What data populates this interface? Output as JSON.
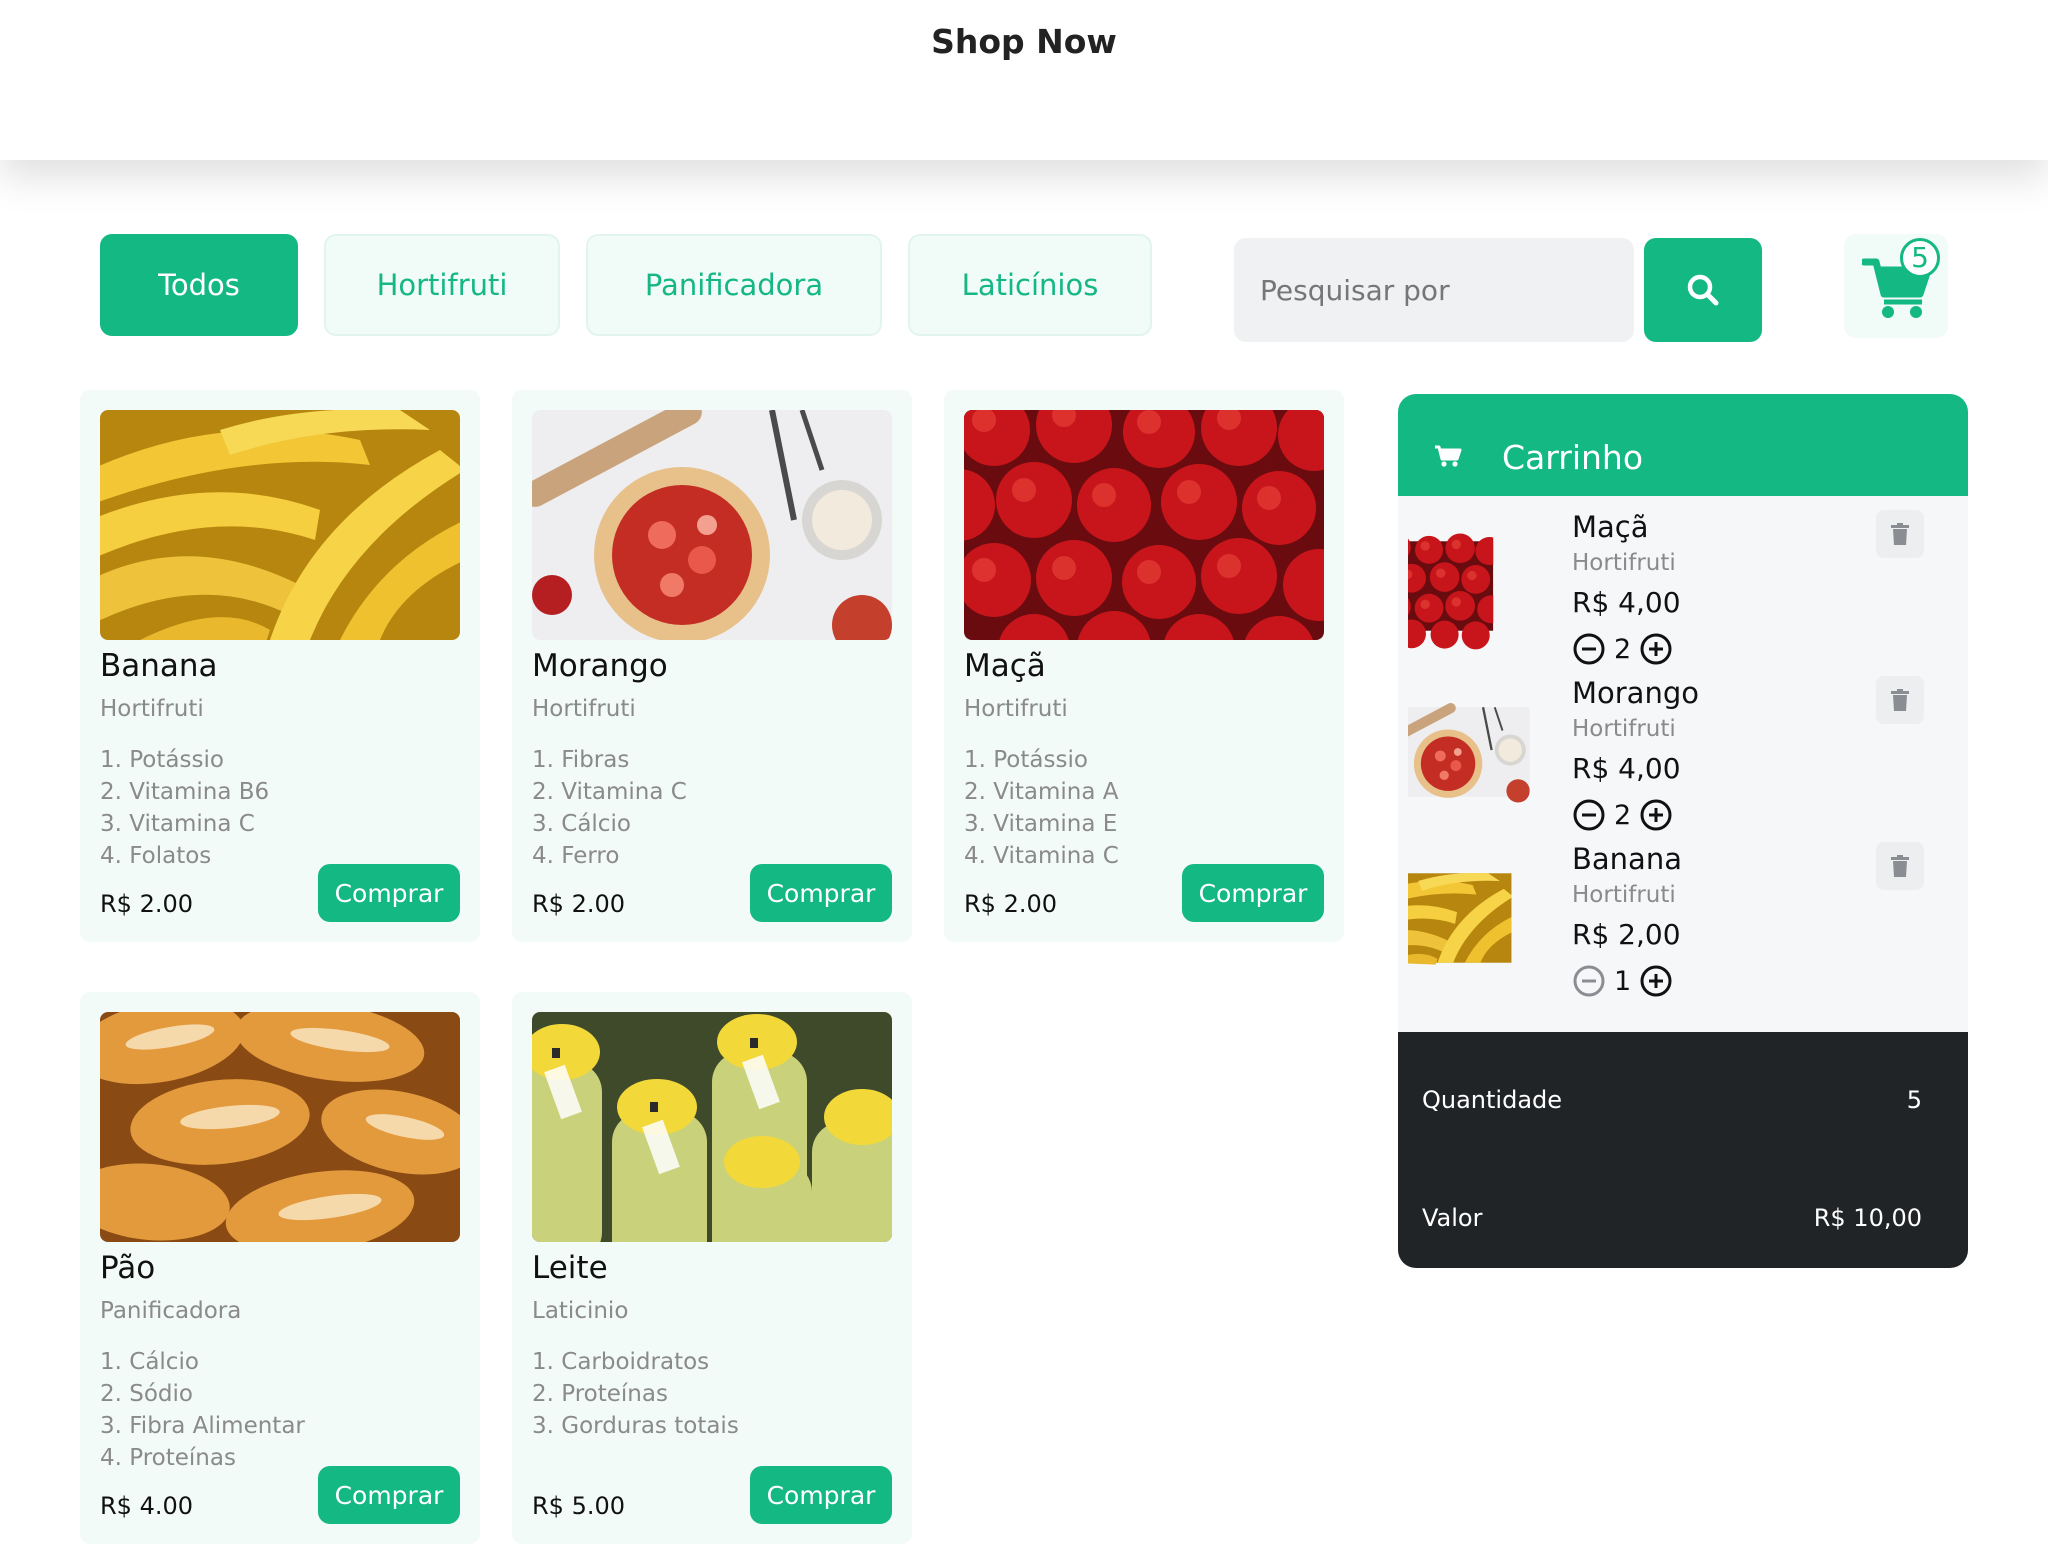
{
  "header": {
    "title": "Shop Now"
  },
  "filters": [
    {
      "label": "Todos",
      "active": true
    },
    {
      "label": "Hortifruti",
      "active": false
    },
    {
      "label": "Panificadora",
      "active": false
    },
    {
      "label": "Laticínios",
      "active": false
    }
  ],
  "search": {
    "placeholder": "Pesquisar por",
    "icon": "search-icon"
  },
  "cart_button": {
    "count": "5",
    "icon": "cart-icon"
  },
  "products": [
    {
      "name": "Banana",
      "category": "Hortifruti",
      "nutrients": [
        "1. Potássio",
        "2. Vitamina B6",
        "3. Vitamina C",
        "4. Folatos"
      ],
      "price": "R$ 2.00",
      "button": "Comprar"
    },
    {
      "name": "Morango",
      "category": "Hortifruti",
      "nutrients": [
        "1. Fibras",
        "2. Vitamina C",
        "3. Cálcio",
        "4. Ferro"
      ],
      "price": "R$ 2.00",
      "button": "Comprar"
    },
    {
      "name": "Maçã",
      "category": "Hortifruti",
      "nutrients": [
        "1. Potássio",
        "2. Vitamina A",
        "3. Vitamina E",
        "4. Vitamina C"
      ],
      "price": "R$ 2.00",
      "button": "Comprar"
    },
    {
      "name": "Pão",
      "category": "Panificadora",
      "nutrients": [
        "1. Cálcio",
        "2. Sódio",
        "3. Fibra Alimentar",
        "4. Proteínas"
      ],
      "price": "R$ 4.00",
      "button": "Comprar"
    },
    {
      "name": "Leite",
      "category": "Laticinio",
      "nutrients": [
        "1. Carboidratos",
        "2. Proteínas",
        "3. Gorduras totais"
      ],
      "price": "R$ 5.00",
      "button": "Comprar"
    }
  ],
  "cart": {
    "title": "Carrinho",
    "items": [
      {
        "name": "Maçã",
        "category": "Hortifruti",
        "price": "R$ 4,00",
        "quantity": "2"
      },
      {
        "name": "Morango",
        "category": "Hortifruti",
        "price": "R$ 4,00",
        "quantity": "2"
      },
      {
        "name": "Banana",
        "category": "Hortifruti",
        "price": "R$ 2,00",
        "quantity": "1"
      }
    ],
    "summary": {
      "quantity_label": "Quantidade",
      "quantity_value": "5",
      "total_label": "Valor",
      "total_value": "R$ 10,00"
    }
  },
  "colors": {
    "accent": "#14b883",
    "card_bg": "#f3fbf8",
    "summary_bg": "#212427"
  }
}
